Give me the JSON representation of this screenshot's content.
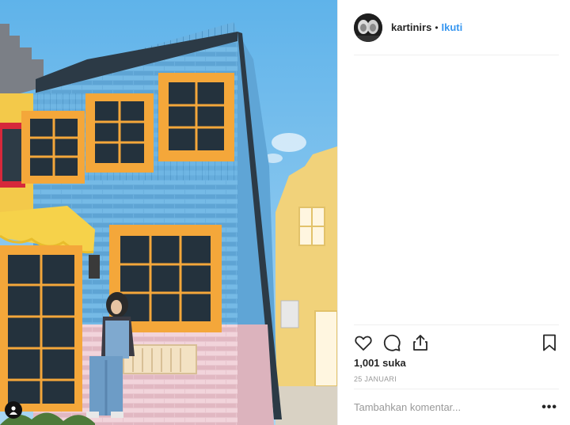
{
  "post": {
    "username": "kartinirs",
    "separator": "•",
    "follow_label": "Ikuti",
    "likes_text": "1,001 suka",
    "date_text": "25 JANUARI",
    "comment_placeholder": "Tambahkan komentar...",
    "more_label": "•••"
  },
  "icons": {
    "like": "heart-icon",
    "comment": "comment-bubble-icon",
    "share": "share-upload-icon",
    "save": "bookmark-icon",
    "tagged_user": "user-icon"
  },
  "colors": {
    "follow_link": "#3897f0",
    "divider": "#efefef",
    "muted_text": "#999999"
  }
}
